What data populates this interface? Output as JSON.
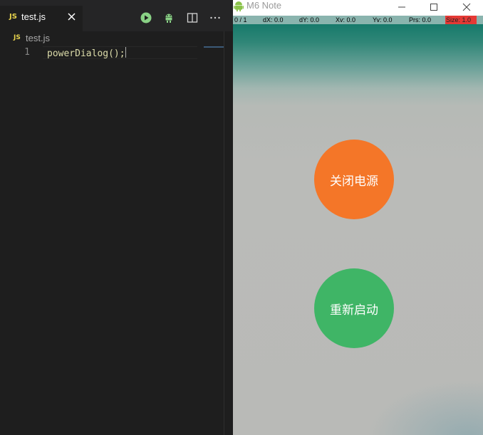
{
  "editor": {
    "tab": {
      "lang_badge": "JS",
      "label": "test.js"
    },
    "breadcrumb": {
      "lang_badge": "JS",
      "label": "test.js"
    },
    "code": {
      "line_number": "1",
      "text": "powerDialog();"
    }
  },
  "emulator": {
    "window_title": "M6 Note",
    "pointer_info": {
      "pointer": "0 / 1",
      "dx": "dX: 0.0",
      "dy": "dY: 0.0",
      "xv": "Xv: 0.0",
      "yv": "Yv: 0.0",
      "prs": "Prs: 0.0",
      "size": "Size: 1.0"
    },
    "buttons": {
      "power_off": "关闭电源",
      "restart": "重新启动"
    }
  },
  "colors": {
    "power_off": "#f47628",
    "restart": "#3fb566",
    "js_badge": "#e8d44d",
    "run_icon": "#89d185"
  },
  "icons": [
    "close-icon",
    "run-icon",
    "debug-icon",
    "split-editor-icon",
    "more-actions-icon",
    "android-icon",
    "minimize-icon",
    "maximize-icon",
    "window-close-icon"
  ]
}
